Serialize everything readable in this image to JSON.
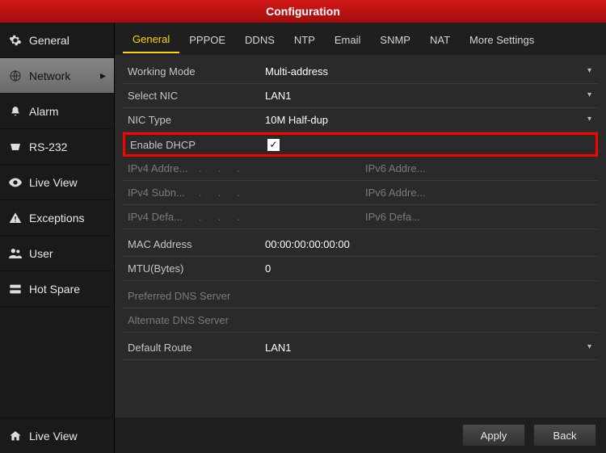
{
  "title": "Configuration",
  "sidebar": {
    "items": [
      {
        "label": "General"
      },
      {
        "label": "Network"
      },
      {
        "label": "Alarm"
      },
      {
        "label": "RS-232"
      },
      {
        "label": "Live View"
      },
      {
        "label": "Exceptions"
      },
      {
        "label": "User"
      },
      {
        "label": "Hot Spare"
      }
    ],
    "active_index": 1,
    "bottom": {
      "label": "Live View"
    }
  },
  "tabs": {
    "items": [
      "General",
      "PPPOE",
      "DDNS",
      "NTP",
      "Email",
      "SNMP",
      "NAT",
      "More Settings"
    ],
    "active_index": 0
  },
  "network": {
    "working_mode": {
      "label": "Working Mode",
      "value": "Multi-address"
    },
    "select_nic": {
      "label": "Select NIC",
      "value": "LAN1"
    },
    "nic_type": {
      "label": "NIC Type",
      "value": "10M Half-dup"
    },
    "enable_dhcp": {
      "label": "Enable DHCP",
      "checked": true
    },
    "ipv4_addr": {
      "label": "IPv4 Addre..."
    },
    "ipv4_subnet": {
      "label": "IPv4 Subn..."
    },
    "ipv4_gateway": {
      "label": "IPv4 Defa..."
    },
    "ipv6_addr": {
      "label": "IPv6 Addre..."
    },
    "ipv6_addr2": {
      "label": "IPv6 Addre..."
    },
    "ipv6_gateway": {
      "label": "IPv6 Defa..."
    },
    "mac": {
      "label": "MAC Address",
      "value": "00:00:00:00:00:00"
    },
    "mtu": {
      "label": "MTU(Bytes)",
      "value": "0"
    },
    "dns1": {
      "label": "Preferred DNS Server",
      "value": ""
    },
    "dns2": {
      "label": "Alternate DNS Server",
      "value": ""
    },
    "default_route": {
      "label": "Default Route",
      "value": "LAN1"
    }
  },
  "footer": {
    "apply": "Apply",
    "back": "Back"
  }
}
